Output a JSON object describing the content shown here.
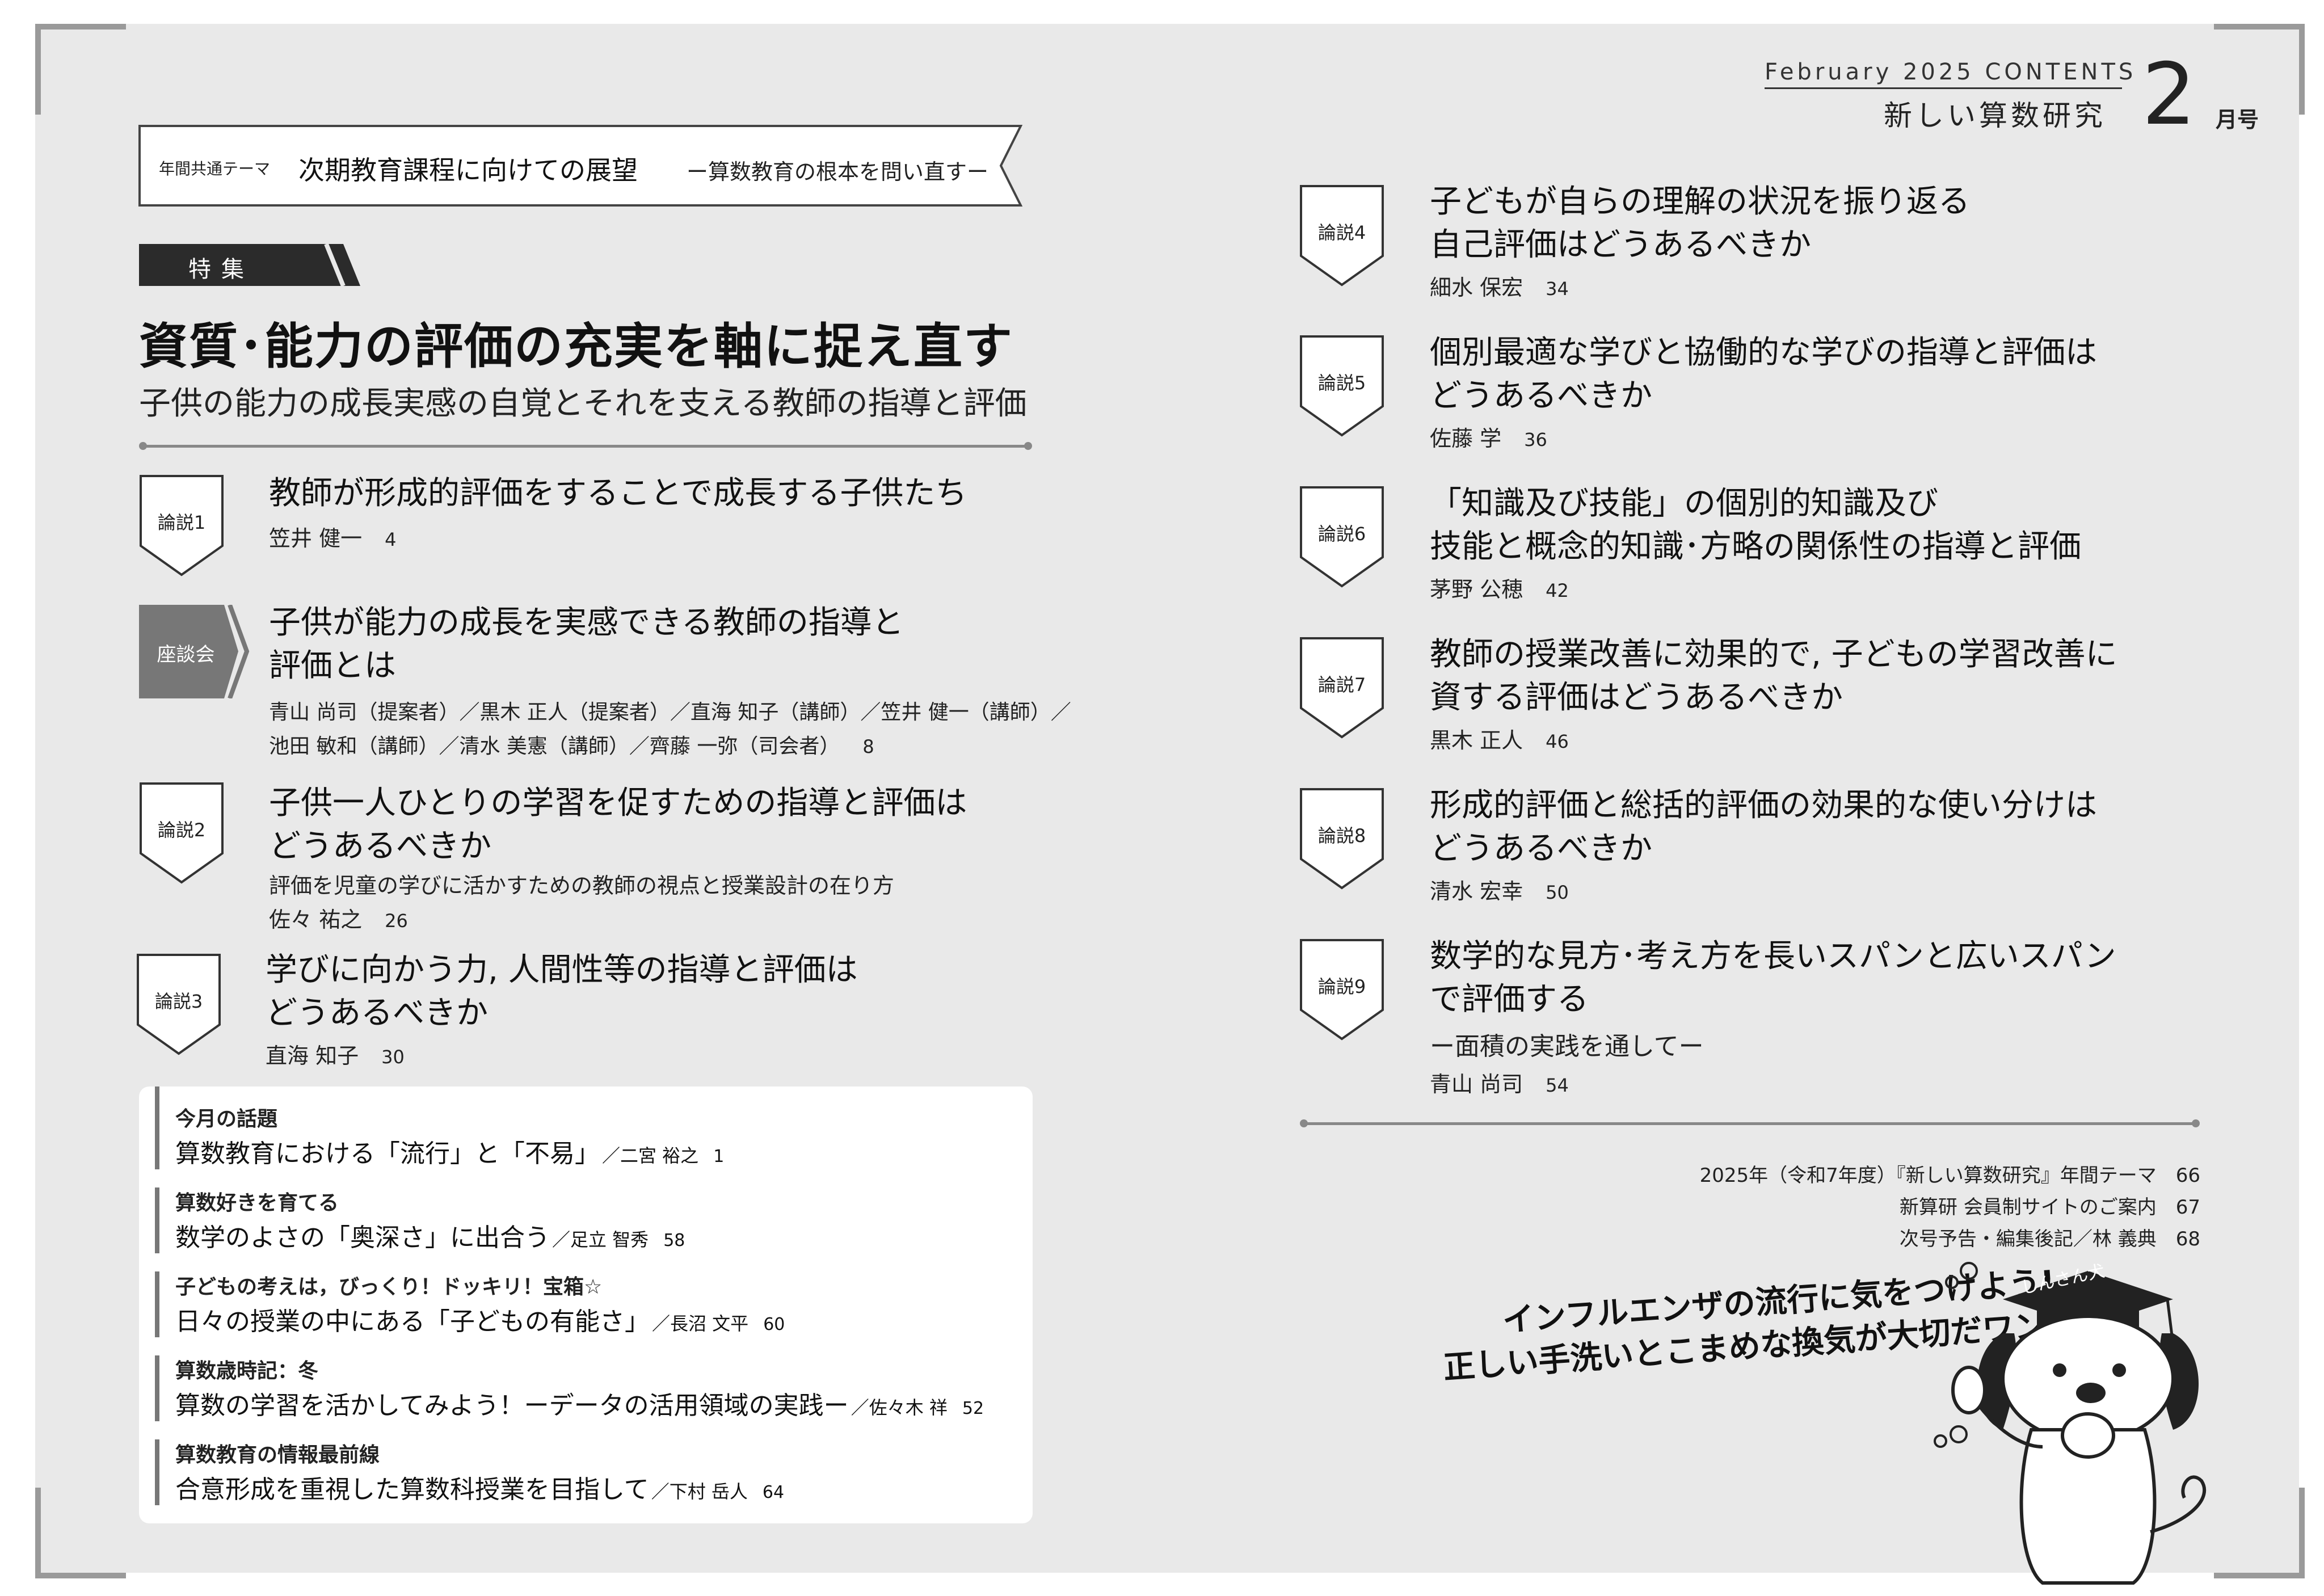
{
  "header": {
    "month_en": "February 2025 CONTENTS",
    "magazine": "新しい算数研究",
    "month_num": "2",
    "month_unit": "月号"
  },
  "theme": {
    "label": "年間共通テーマ",
    "main": "次期教育課程に向けての展望",
    "sub": "ー算数教育の根本を問い直すー"
  },
  "feature": {
    "tag": "特集",
    "title": "資質･能力の評価の充実を軸に捉え直す",
    "subtitle": "子供の能力の成長実感の自覚とそれを支える教師の指導と評価"
  },
  "left_articles": [
    {
      "tag": "論説1",
      "title_lines": [
        "教師が形成的評価をすることで成長する子供たち"
      ],
      "author": "笠井 健一",
      "page": "4"
    },
    {
      "tag": "論説2",
      "title_lines": [
        "子供一人ひとりの学習を促すための指導と評価は",
        "どうあるべきか"
      ],
      "subtitle": "評価を児童の学びに活かすための教師の視点と授業設計の在り方",
      "author": "佐々 祐之",
      "page": "26"
    },
    {
      "tag": "論説3",
      "title_lines": [
        "学びに向かう力, 人間性等の指導と評価は",
        "どうあるべきか"
      ],
      "author": "直海 知子",
      "page": "30"
    }
  ],
  "roundtable": {
    "tag": "座談会",
    "title_lines": [
      "子供が能力の成長を実感できる教師の指導と",
      "評価とは"
    ],
    "people_lines": [
      "青山 尚司（提案者）／黒木 正人（提案者）／直海 知子（講師）／笠井 健一（講師）／",
      "池田 敏和（講師）／清水 美憲（講師）／齊藤 一弥（司会者）"
    ],
    "page": "8"
  },
  "right_articles": [
    {
      "tag": "論説4",
      "title_lines": [
        "子どもが自らの理解の状況を振り返る",
        "自己評価はどうあるべきか"
      ],
      "author": "細水 保宏",
      "page": "34"
    },
    {
      "tag": "論説5",
      "title_lines": [
        "個別最適な学びと協働的な学びの指導と評価は",
        "どうあるべきか"
      ],
      "author": "佐藤 学",
      "page": "36"
    },
    {
      "tag": "論説6",
      "title_lines": [
        "「知識及び技能」の個別的知識及び",
        "技能と概念的知識･方略の関係性の指導と評価"
      ],
      "author": "茅野 公穂",
      "page": "42"
    },
    {
      "tag": "論説7",
      "title_lines": [
        "教師の授業改善に効果的で, 子どもの学習改善に",
        "資する評価はどうあるべきか"
      ],
      "author": "黒木 正人",
      "page": "46"
    },
    {
      "tag": "論説8",
      "title_lines": [
        "形成的評価と総括的評価の効果的な使い分けは",
        "どうあるべきか"
      ],
      "author": "清水 宏幸",
      "page": "50"
    },
    {
      "tag": "論説9",
      "title_lines": [
        "数学的な見方･考え方を長いスパンと広いスパン",
        "で評価する"
      ],
      "subtitle": "ー面積の実践を通してー",
      "author": "青山 尚司",
      "page": "54"
    }
  ],
  "columns": [
    {
      "heading": "今月の話題",
      "title": "算数教育における「流行」と「不易」",
      "author": "／二宮 裕之",
      "page": "1"
    },
    {
      "heading": "算数好きを育てる",
      "title": "数学のよさの「奥深さ」に出合う",
      "author": "／足立 智秀",
      "page": "58"
    },
    {
      "heading": "子どもの考えは，びっくり！ドッキリ！宝箱☆",
      "title": "日々の授業の中にある「子どもの有能さ」",
      "author": "／長沼 文平",
      "page": "60"
    },
    {
      "heading": "算数歳時記：冬",
      "title": "算数の学習を活かしてみよう！ーデータの活用領域の実践ー",
      "author": "／佐々木 祥",
      "page": "52"
    },
    {
      "heading": "算数教育の情報最前線",
      "title": "合意形成を重視した算数科授業を目指して",
      "author": "／下村 岳人",
      "page": "64"
    }
  ],
  "misc": [
    {
      "text": "2025年（令和7年度）『新しい算数研究』年間テーマ",
      "page": "66"
    },
    {
      "text": "新算研 会員制サイトのご案内",
      "page": "67"
    },
    {
      "text": "次号予告・編集後記／林 義典",
      "page": "68"
    }
  ],
  "mascot": {
    "message_lines": [
      "インフルエンザの流行に気をつけよう!",
      "正しい手洗いとこまめな換気が大切だワン!"
    ],
    "hat_label": "しんさん犬"
  }
}
